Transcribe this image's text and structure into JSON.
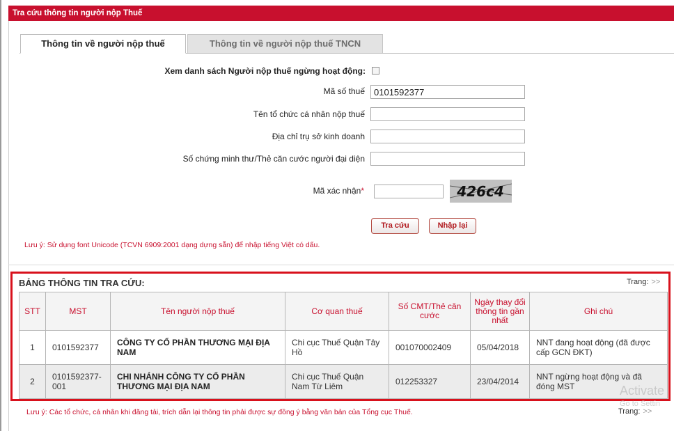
{
  "window": {
    "title": "Tra cứu thông tin người nộp Thuế"
  },
  "tabs": [
    {
      "label": "Thông tin về người nộp thuế",
      "active": true
    },
    {
      "label": "Thông tin về người nộp thuế TNCN",
      "active": false
    }
  ],
  "form": {
    "inactive_list_label": "Xem danh sách Người nộp thuế ngừng hoạt động:",
    "inactive_list_checked": false,
    "tax_code_label": "Mã số thuế",
    "tax_code_value": "0101592377",
    "org_name_label": "Tên tổ chức cá nhân nộp thuế",
    "org_name_value": "",
    "address_label": "Địa chỉ trụ sở kinh doanh",
    "address_value": "",
    "id_label": "Số chứng minh thư/Thẻ căn cước người đại diện",
    "id_value": "",
    "captcha_label": "Mã xác nhận",
    "captcha_required_mark": "*",
    "captcha_value": "",
    "captcha_image_text": "426c4",
    "search_button": "Tra cứu",
    "reset_button": "Nhập lại",
    "unicode_note": "Lưu ý: Sử dụng font Unicode (TCVN 6909:2001 dạng dựng sẵn) để nhập tiếng Việt có dấu."
  },
  "results": {
    "title": "BẢNG THÔNG TIN TRA CỨU:",
    "page_label": "Trang:",
    "next_label": ">>",
    "columns": [
      "STT",
      "MST",
      "Tên người nộp thuế",
      "Cơ quan thuế",
      "Số CMT/Thẻ căn cước",
      "Ngày thay đổi thông tin gần nhất",
      "Ghi chú"
    ],
    "rows": [
      {
        "stt": "1",
        "mst": "0101592377",
        "name": "CÔNG TY CỔ PHẦN THƯƠNG MẠI ĐỊA NAM",
        "agency": "Chi cục Thuế Quận Tây Hồ",
        "id_no": "001070002409",
        "changed": "05/04/2018",
        "note": "NNT đang hoạt động (đã được cấp GCN ĐKT)"
      },
      {
        "stt": "2",
        "mst": "0101592377-001",
        "name": "CHI NHÁNH CÔNG TY CỔ PHẦN THƯƠNG MẠI ĐỊA NAM",
        "agency": "Chi cục Thuế Quận Nam Từ Liêm",
        "id_no": "012253327",
        "changed": "23/04/2014",
        "note": "NNT ngừng hoạt động và đã đóng MST"
      }
    ],
    "footer_note": "Lưu ý: Các tổ chức, cá nhân khi đăng tải, trích dẫn lại thông tin phải được sự đồng ý bằng văn bản của Tổng cục Thuế."
  },
  "watermark": {
    "line1": "Activate",
    "line2": "Go to Settin"
  },
  "colors": {
    "brand_red": "#c8102e",
    "highlight_box": "#d8111c"
  }
}
